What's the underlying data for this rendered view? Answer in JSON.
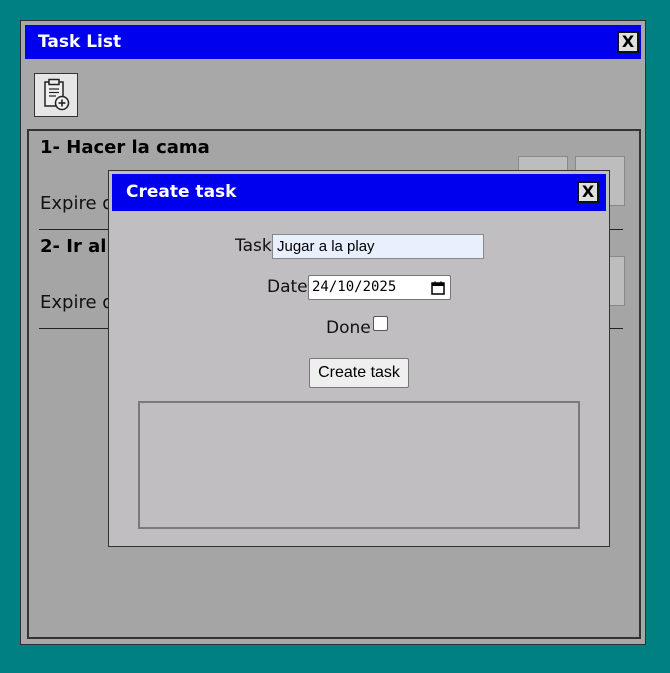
{
  "window": {
    "title": "Task List",
    "close_label": "X"
  },
  "toolbar": {
    "add_task_icon": "clipboard-add-icon"
  },
  "tasks": [
    {
      "title": "1- Hacer la cama",
      "expire": "Expire d"
    },
    {
      "title": "2- Ir al s",
      "expire": "Expire d"
    }
  ],
  "modal": {
    "title": "Create task",
    "close_label": "X",
    "task_label": "Task",
    "task_value": "Jugar a la play",
    "date_label": "Date",
    "date_value": "24/10/2025",
    "done_label": "Done",
    "done_checked": false,
    "submit_label": "Create task"
  },
  "colors": {
    "desktop": "#008080",
    "titlebar": "#0000ee",
    "window_bg": "#a8a8a8",
    "modal_bg": "#c0bec1"
  }
}
